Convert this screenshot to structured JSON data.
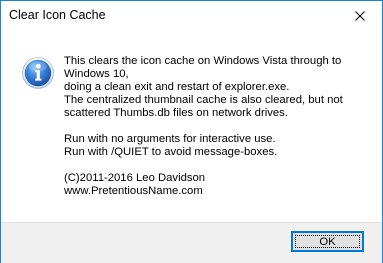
{
  "window": {
    "title": "Clear Icon Cache",
    "close_icon": "close-icon",
    "accent_color": "#1883d7"
  },
  "message": {
    "icon": "info-icon",
    "lines": [
      "This clears the icon cache on Windows Vista through to",
      "Windows 10,",
      "doing a clean exit and restart of explorer.exe.",
      "The centralized thumbnail cache is also cleared, but not",
      "scattered Thumbs.db files on network drives.",
      "",
      "Run with no arguments for interactive use.",
      "Run with /QUIET to avoid message-boxes.",
      "",
      "(C)2011-2016 Leo Davidson",
      "www.PretentiousName.com"
    ]
  },
  "buttons": {
    "ok_label": "OK"
  }
}
